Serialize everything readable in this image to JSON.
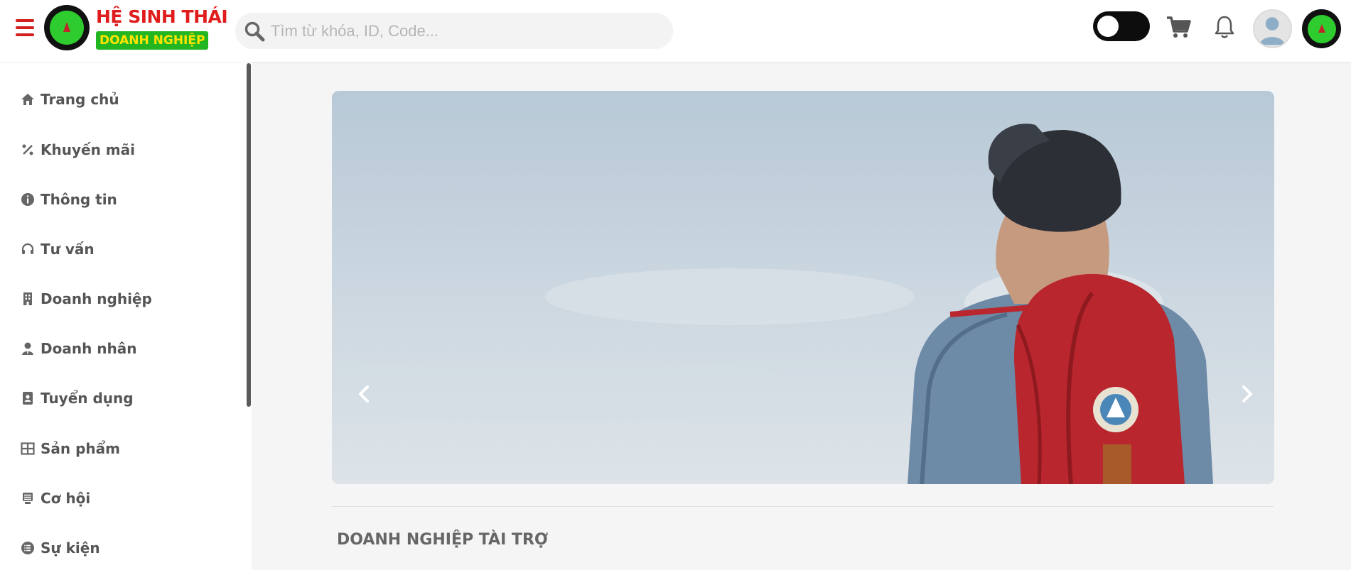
{
  "header": {
    "logo_top": "HỆ SINH THÁI",
    "logo_bottom": "DOANH NGHIỆP",
    "search_placeholder": "Tìm từ khóa, ID, Code..."
  },
  "sidebar": {
    "items": [
      {
        "label": "Trang chủ",
        "icon": "home-icon"
      },
      {
        "label": "Khuyến mãi",
        "icon": "percent-icon"
      },
      {
        "label": "Thông tin",
        "icon": "info-icon"
      },
      {
        "label": "Tư vấn",
        "icon": "headset-icon"
      },
      {
        "label": "Doanh nghiệp",
        "icon": "building-icon"
      },
      {
        "label": "Doanh nhân",
        "icon": "user-tie-icon"
      },
      {
        "label": "Tuyển dụng",
        "icon": "contact-book-icon"
      },
      {
        "label": "Sản phẩm",
        "icon": "grid-icon"
      },
      {
        "label": "Cơ hội",
        "icon": "list-icon"
      },
      {
        "label": "Sự kiện",
        "icon": "list-circle-icon"
      }
    ]
  },
  "main": {
    "section_title": "DOANH NGHIỆP TÀI TRỢ"
  },
  "colors": {
    "brand_red": "#e01c1c",
    "brand_green": "#22b622",
    "brand_yellow": "#ffe400",
    "sidebar_text": "#555555"
  }
}
